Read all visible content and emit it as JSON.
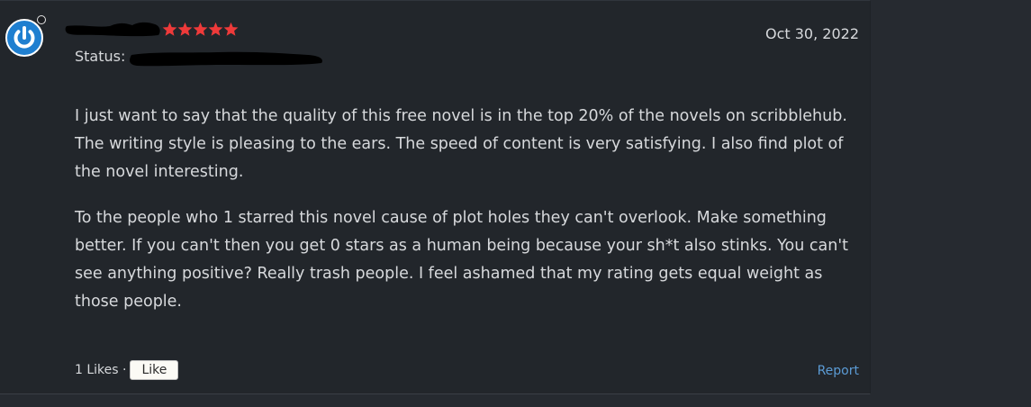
{
  "review": {
    "status_label": "Status:",
    "date": "Oct 30, 2022",
    "rating_stars": 5,
    "paragraphs": [
      "I just want to say that the quality of this free novel is in the top 20% of the novels on scribblehub. The writing style is pleasing to the ears. The speed of content is very satisfying. I also find plot of the novel interesting.",
      "To the people who 1 starred this novel cause of plot holes they can't overlook. Make something better. If you can't then you get 0 stars as a human being because your sh*t also stinks. You can't see anything positive? Really trash people. I feel ashamed that my rating gets equal weight as those people."
    ]
  },
  "footer": {
    "likes_text": "1 Likes ·",
    "like_label": "Like",
    "report_label": "Report"
  },
  "colors": {
    "star": "#ee3a3a",
    "avatar_bg": "#1f7fd0",
    "link": "#5b9bd5",
    "card_bg": "#22262b"
  },
  "icons": {
    "avatar": "power-symbol-icon",
    "star": "star-icon",
    "presence": "online-status-icon"
  }
}
